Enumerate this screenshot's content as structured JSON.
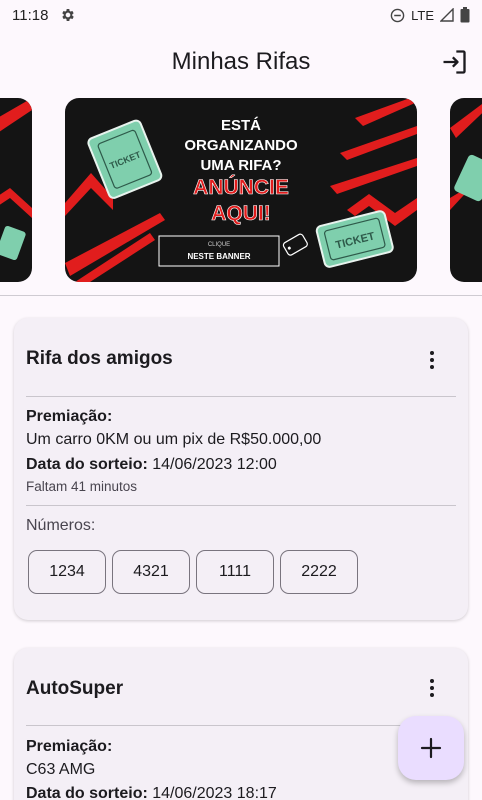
{
  "status": {
    "time": "11:18",
    "network": "LTE"
  },
  "header": {
    "title": "Minhas Rifas"
  },
  "banner": {
    "line1": "ESTÁ",
    "line2": "ORGANIZANDO",
    "line3": "UMA RIFA?",
    "line4": "ANÚNCIE",
    "line5": "AQUI!",
    "cta_small": "CLIQUE",
    "cta_main": "NESTE BANNER",
    "ticket_label": "TICKET"
  },
  "raffles": [
    {
      "name": "Rifa dos amigos",
      "prize_label": "Premiação:",
      "prize": "Um carro 0KM ou um pix de R$50.000,00",
      "date_label": "Data do sorteio:",
      "date": "14/06/2023 12:00",
      "remaining": "Faltam 41 minutos",
      "numbers_label": "Números:",
      "numbers": [
        "1234",
        "4321",
        "1111",
        "2222"
      ]
    },
    {
      "name": "AutoSuper",
      "prize_label": "Premiação:",
      "prize": "C63 AMG",
      "date_label": "Data do sorteio:",
      "date": "14/06/2023 18:17"
    }
  ],
  "colors": {
    "background": "#fdf8fd",
    "card": "#f4eff6",
    "fab": "#eaddff",
    "banner_red": "#e11d1d"
  },
  "icons": {
    "settings": "gear-icon",
    "logout": "logout-icon",
    "add": "plus-icon",
    "menu": "more-vert-icon"
  }
}
